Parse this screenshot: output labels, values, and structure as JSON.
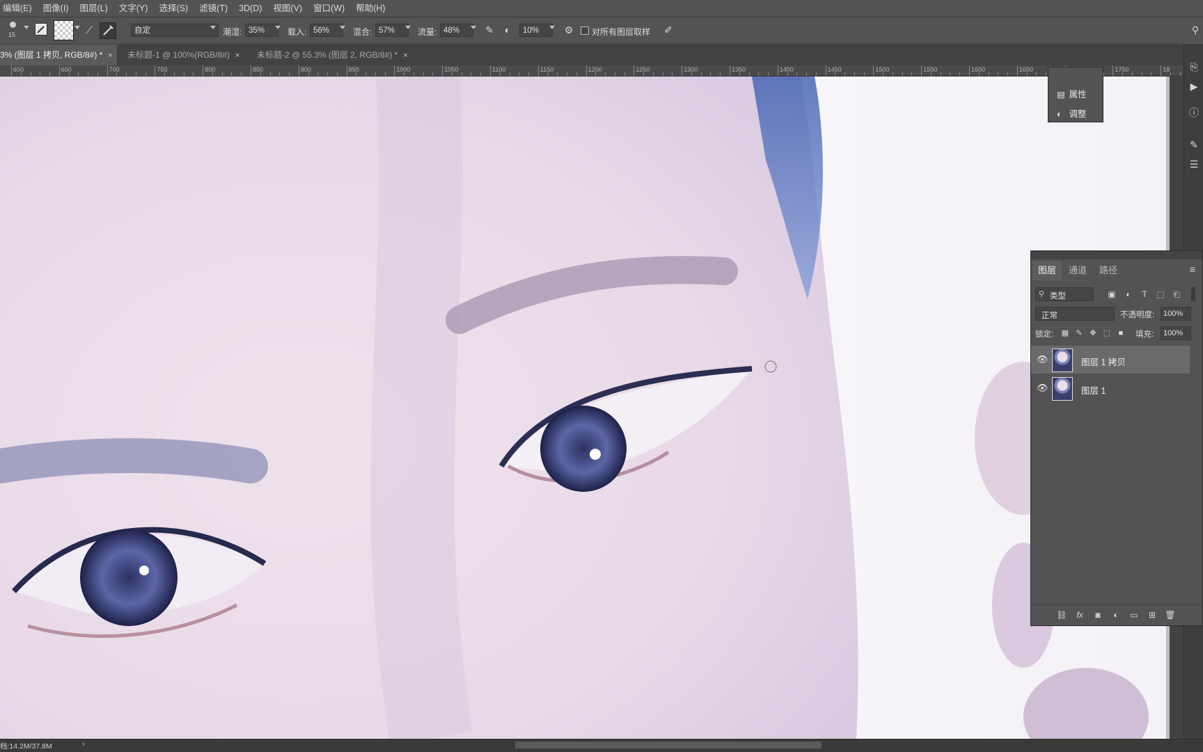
{
  "menu": [
    "编辑(E)",
    "图像(I)",
    "图层(L)",
    "文字(Y)",
    "选择(S)",
    "滤镜(T)",
    "3D(D)",
    "视图(V)",
    "窗口(W)",
    "帮助(H)"
  ],
  "options": {
    "brush_size": "15",
    "preset": "自定",
    "wetness_label": "潮湿:",
    "wetness": "35%",
    "load_label": "载入:",
    "load": "56%",
    "mix_label": "混合:",
    "mix": "57%",
    "flow_label": "流量:",
    "flow": "48%",
    "smoothing": "10%",
    "sample_all_label": "对所有图层取样"
  },
  "tabs": [
    {
      "label": "3% (图层 1 拷贝, RGB/8#) *",
      "close": "×"
    },
    {
      "label": "未标题-1 @ 100%(RGB/8#)",
      "close": "×"
    },
    {
      "label": "未标题-2 @ 55.3% (图层 2, RGB/8#) *",
      "close": "×"
    }
  ],
  "ruler": [
    "600",
    "650",
    "700",
    "750",
    "800",
    "850",
    "900",
    "950",
    "1000",
    "1050",
    "1100",
    "1150",
    "1200",
    "1250",
    "1300",
    "1350",
    "1400",
    "1450",
    "1500",
    "1550",
    "1600",
    "1650",
    "1700",
    "1750",
    "18"
  ],
  "mini_panel": {
    "properties": "属性",
    "adjustments": "调整"
  },
  "layers_panel": {
    "tabs": [
      "图层",
      "通道",
      "路径"
    ],
    "filter_kind": "类型",
    "blend_mode": "正常",
    "opacity_label": "不透明度:",
    "opacity": "100%",
    "lock_label": "锁定:",
    "fill_label": "填充:",
    "fill": "100%",
    "layers": [
      {
        "name": "图层 1 拷贝",
        "selected": true
      },
      {
        "name": "图层 1",
        "selected": false
      }
    ]
  },
  "status": "档:14.2M/37.8M",
  "colors": {
    "menu_bg": "#535353",
    "panel_bg": "#535353",
    "tab_active": "#5b5b5b"
  }
}
